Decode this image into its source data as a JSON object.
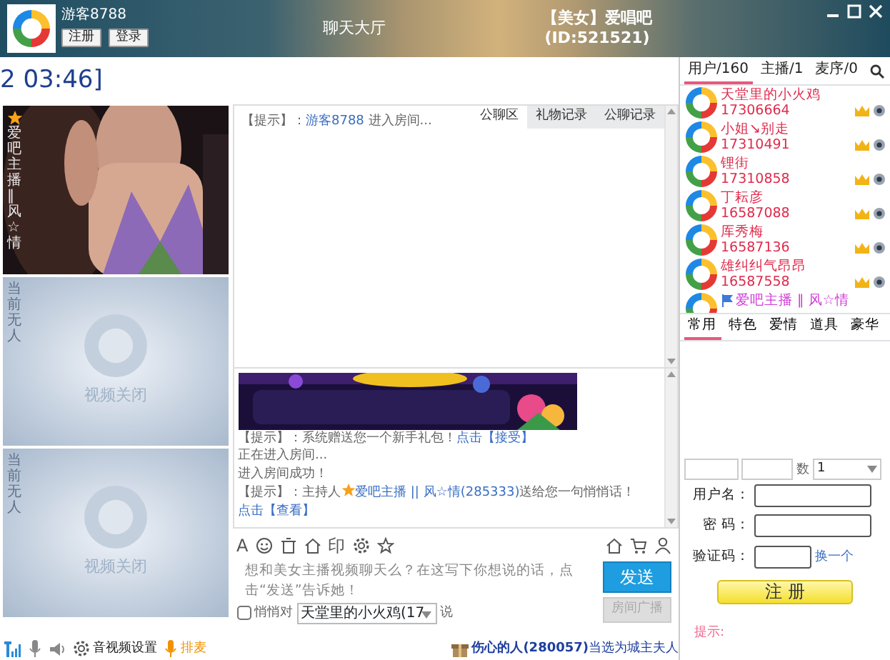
{
  "header": {
    "username": "游客8788",
    "buttons": [
      "注册",
      "登录"
    ],
    "hall": "聊天大厅",
    "room_title": "【美女】爱唱吧",
    "room_id": "(ID:521521)"
  },
  "clock": "2 03:46]",
  "videos": [
    {
      "kind": "live",
      "caption": "爱吧主播‖风☆情"
    },
    {
      "kind": "off",
      "caption": "当前无人",
      "status": "视频关闭"
    },
    {
      "kind": "off",
      "caption": "当前无人",
      "status": "视频关闭"
    }
  ],
  "chat_tabs": [
    {
      "label": "公聊区",
      "selected": true
    },
    {
      "label": "礼物记录",
      "selected": false
    },
    {
      "label": "公聊记录",
      "selected": false
    }
  ],
  "public_messages": [
    {
      "parts": [
        {
          "kind": "plain",
          "text": "【提示】："
        },
        {
          "kind": "link",
          "text": "游客8788"
        },
        {
          "kind": "plain",
          "text": " 进入房间..."
        }
      ]
    }
  ],
  "private_messages": [
    {
      "parts": [
        {
          "kind": "plain",
          "text": "【提示】：系统赠送您一个新手礼包！"
        },
        {
          "kind": "link",
          "text": "点击【接受】"
        }
      ]
    },
    {
      "parts": [
        {
          "kind": "plain",
          "text": "正在进入房间..."
        }
      ]
    },
    {
      "parts": [
        {
          "kind": "plain",
          "text": "进入房间成功！"
        }
      ]
    },
    {
      "parts": [
        {
          "kind": "plain",
          "text": "【提示】：主持人"
        },
        {
          "kind": "star"
        },
        {
          "kind": "link",
          "text": "爱吧主播 || 风☆情(285333)"
        },
        {
          "kind": "plain",
          "text": "送给您一句悄悄话！"
        }
      ]
    },
    {
      "parts": [
        {
          "kind": "link",
          "text": "点击【查看】"
        }
      ]
    }
  ],
  "toolbar_left": [
    {
      "kind": "char",
      "text": "A"
    },
    {
      "kind": "smiley"
    },
    {
      "kind": "trash"
    },
    {
      "kind": "house"
    },
    {
      "kind": "char",
      "text": "印"
    },
    {
      "kind": "gear"
    },
    {
      "kind": "star"
    }
  ],
  "toolbar_right": [
    {
      "kind": "house"
    },
    {
      "kind": "cart"
    },
    {
      "kind": "person"
    }
  ],
  "composer": {
    "placeholder": "想和美女主播视频聊天么？在这写下你想说的话，点击“发送”告诉她！",
    "send": "发送",
    "broadcast": {
      "label": "房间广播",
      "disabled": true
    },
    "whisper": {
      "label": "悄悄对",
      "checked": false
    },
    "target": "天堂里的小火鸡(17",
    "say": "说"
  },
  "status_bar": {
    "settings": "音视频设置",
    "queue": "排麦",
    "ticker": "**伤心的人(280057)**当选为城主夫人"
  },
  "user_tabs": [
    {
      "label": "用户/160",
      "selected": true
    },
    {
      "label": "主播/1",
      "selected": false
    },
    {
      "label": "麦序/0",
      "selected": false
    }
  ],
  "users": [
    {
      "kind": "guest",
      "name": "天堂里的小火鸡",
      "id": "17306664"
    },
    {
      "kind": "guest",
      "name": "小姐↘别走",
      "id": "17310491"
    },
    {
      "kind": "guest",
      "name": "锂街",
      "id": "17310858"
    },
    {
      "kind": "guest",
      "name": "丁耘彦",
      "id": "16587088"
    },
    {
      "kind": "guest",
      "name": "厍秀梅",
      "id": "16587136"
    },
    {
      "kind": "guest",
      "name": "雄纠纠气昂昂",
      "id": "16587558"
    },
    {
      "kind": "host",
      "name": "爱吧主播 ‖ 风☆情"
    }
  ],
  "gift_tabs": [
    {
      "label": "常用",
      "selected": true
    },
    {
      "label": "特色",
      "selected": false
    },
    {
      "label": "爱情",
      "selected": false
    },
    {
      "label": "道具",
      "selected": false
    },
    {
      "label": "豪华",
      "selected": false
    }
  ],
  "gift_form": {
    "count_label": "数",
    "count": "1"
  },
  "register": {
    "fields": [
      {
        "label": "用户名：",
        "kind": "text"
      },
      {
        "label": "密 码：",
        "kind": "text"
      },
      {
        "label": "验证码：",
        "kind": "captcha",
        "link": "换一个"
      }
    ],
    "button": "注 册",
    "tip": "提示:"
  }
}
